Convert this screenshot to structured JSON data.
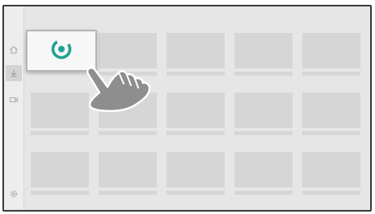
{
  "colors": {
    "screen_bg": "#e6e6e6",
    "screen_border": "#3a3a3a",
    "placeholder": "#d6d6d6",
    "app_icon_teal": "#1fa292",
    "cursor_gray": "#8e8e8e"
  },
  "sidebar": {
    "items": [
      {
        "icon": "home-icon",
        "active": false
      },
      {
        "icon": "download-icon",
        "active": true
      },
      {
        "icon": "video-icon",
        "active": false
      },
      {
        "icon": "settings-icon",
        "active": false
      }
    ]
  },
  "grid": {
    "rows": 3,
    "columns": 5
  },
  "focused_tile": {
    "icon": "app-logo-icon"
  },
  "cursor": {
    "icon": "pointing-hand-icon"
  }
}
